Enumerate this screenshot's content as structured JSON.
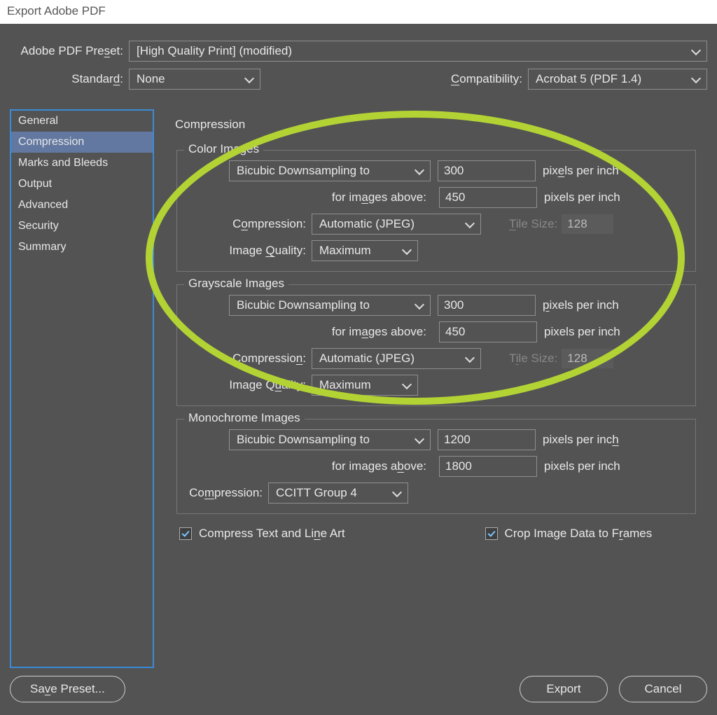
{
  "window": {
    "title": "Export Adobe PDF"
  },
  "top": {
    "preset_label": "Adobe PDF Preset:",
    "preset_value": "[High Quality Print] (modified)",
    "standard_label": "Standard:",
    "standard_value": "None",
    "compat_label": "Compatibility:",
    "compat_value": "Acrobat 5 (PDF 1.4)"
  },
  "sidebar": {
    "items": [
      "General",
      "Compression",
      "Marks and Bleeds",
      "Output",
      "Advanced",
      "Security",
      "Summary"
    ],
    "selected_index": 1
  },
  "panel": {
    "title": "Compression",
    "color": {
      "legend": "Color Images",
      "downsample_mode": "Bicubic Downsampling to",
      "ppi": "300",
      "ppi_unit_html": "pixels_per_inch",
      "above_label_html": "for_images_above",
      "above_ppi": "450",
      "compression_label": "Compression:",
      "compression_value": "Automatic (JPEG)",
      "tilesize_label": "Tile Size:",
      "tilesize_value": "128",
      "quality_label": "Image Quality:",
      "quality_value": "Maximum"
    },
    "gray": {
      "legend": "Grayscale Images",
      "downsample_mode": "Bicubic Downsampling to",
      "ppi": "300",
      "above_ppi": "450",
      "compression_value": "Automatic (JPEG)",
      "tilesize_value": "128",
      "quality_value": "Maximum"
    },
    "mono": {
      "legend": "Monochrome Images",
      "downsample_mode": "Bicubic Downsampling to",
      "ppi": "1200",
      "above_ppi": "1800",
      "compression_label": "Compression:",
      "compression_value": "CCITT Group 4"
    },
    "checks": {
      "compress_text": "Compress Text and Line Art",
      "crop_image": "Crop Image Data to Frames"
    }
  },
  "footer": {
    "save_preset": "Save Preset...",
    "export": "Export",
    "cancel": "Cancel"
  }
}
